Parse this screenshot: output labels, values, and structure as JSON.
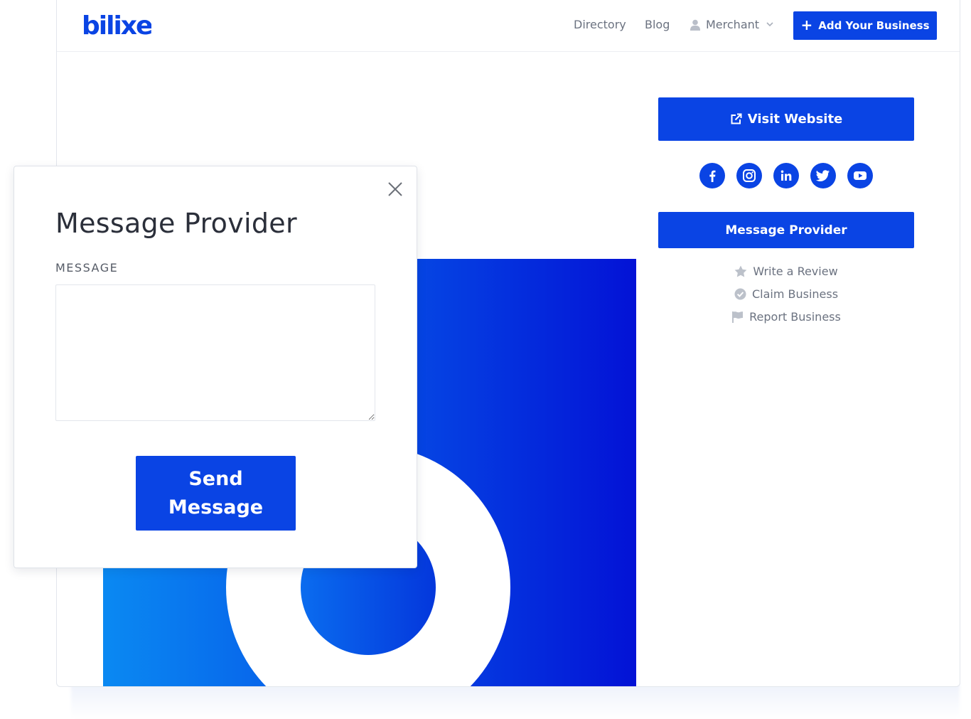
{
  "brand": {
    "logo_text": "bilixe",
    "accent": "#0a44e4"
  },
  "nav": {
    "directory": "Directory",
    "blog": "Blog",
    "merchant": "Merchant",
    "add_business": "Add Your Business"
  },
  "sidebar": {
    "visit_website": "Visit Website",
    "socials": [
      "facebook-icon",
      "instagram-icon",
      "linkedin-icon",
      "twitter-icon",
      "youtube-icon"
    ],
    "message_provider": "Message Provider",
    "links": [
      {
        "label": "Write a Review",
        "icon": "star-icon"
      },
      {
        "label": "Claim Business",
        "icon": "check-circle-icon"
      },
      {
        "label": "Report Business",
        "icon": "flag-icon"
      }
    ]
  },
  "modal": {
    "title": "Message Provider",
    "message_label": "MESSAGE",
    "message_value": "",
    "send_label": "Send Message"
  }
}
